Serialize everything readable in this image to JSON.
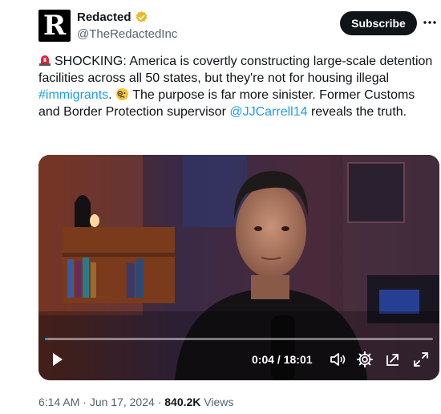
{
  "author": {
    "avatar_letter": "R",
    "name": "Redacted",
    "handle": "@TheRedactedInc",
    "verified_color": "#e8b829"
  },
  "actions": {
    "subscribe_label": "Subscribe",
    "more_icon": "more-icon"
  },
  "tweet": {
    "part1": "SHOCKING: America is covertly constructing large-scale detention facilities across all 50 states, but they're not for housing illegal ",
    "hashtag": "#immigrants",
    "part2": ". ",
    "part3": " The purpose is far more sinister. Former Customs and Border Protection supervisor ",
    "mention": "@JJCarrell14",
    "part4": " reveals the truth.",
    "link_color": "#1d9bf0"
  },
  "video": {
    "current_time": "0:04",
    "separator": " / ",
    "duration": "18:01",
    "progress_fraction": 0.004
  },
  "meta": {
    "time": "6:14 AM",
    "dot1": " · ",
    "date": "Jun 17, 2024",
    "dot2": " · ",
    "views_count": "840.2K",
    "views_label": " Views"
  }
}
